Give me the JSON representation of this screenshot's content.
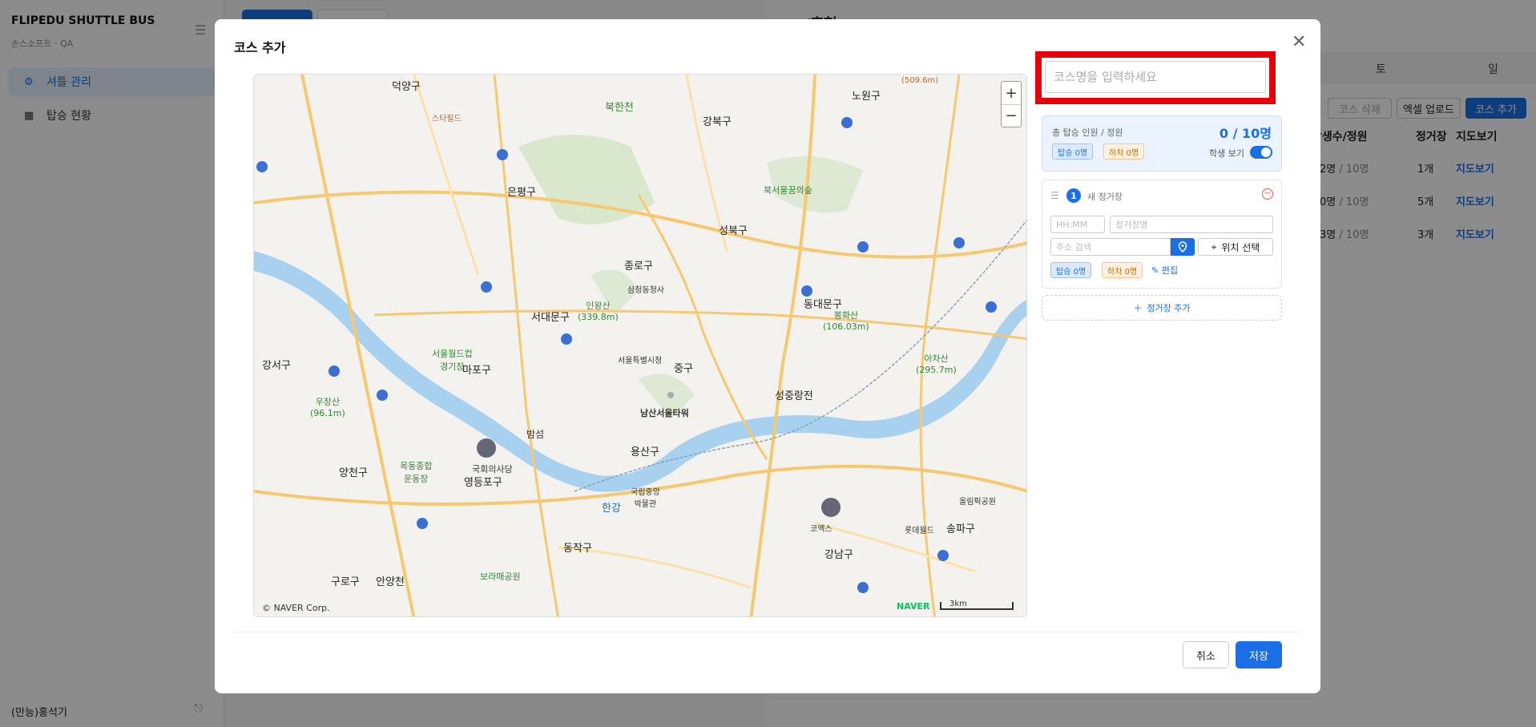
{
  "sidebar": {
    "brand": "FLIPEDU SHUTTLE BUS",
    "brand_sub": "손스소프트 · QA",
    "items": [
      {
        "label": "셔틀 관리",
        "icon": "gear-icon"
      },
      {
        "label": "탑승 현황",
        "icon": "calendar-icon"
      }
    ],
    "user": "(만능)홍석기"
  },
  "drawer": {
    "title": "…/훈협",
    "tabs": [
      "토",
      "일"
    ],
    "buttons": {
      "delete": "코스 삭제",
      "excel": "엑셀 업로드",
      "add": "코스 추가"
    },
    "columns": [
      "학생수/정원",
      "정거장",
      "지도보기"
    ],
    "rows": [
      {
        "students": "2명",
        "capacity": "/ 10명",
        "stops": "1개",
        "map": "지도보기"
      },
      {
        "students": "0명",
        "capacity": "/ 10명",
        "stops": "5개",
        "map": "지도보기"
      },
      {
        "students": "3명",
        "capacity": "/ 10명",
        "stops": "3개",
        "map": "지도보기"
      }
    ]
  },
  "modal": {
    "title": "코스 추가",
    "course_name_placeholder": "코스명을 입력하세요",
    "summary": {
      "label": "총 탑승 인원 / 정원",
      "value": "0 / 10명",
      "board": "탑승 0명",
      "alight": "하차 0명",
      "toggle_label": "학생 보기",
      "toggle_on": true
    },
    "stop": {
      "number": "1",
      "title": "새 정거장",
      "time_placeholder": "HH:MM",
      "name_placeholder": "정거장명",
      "address_placeholder": "주소 검색",
      "locate_label": "위치 선택",
      "board": "탑승 0명",
      "alight": "하차 0명",
      "edit": "편집"
    },
    "add_stop": "정거장 추가",
    "cancel": "취소",
    "save": "저장"
  },
  "map": {
    "copyright": "© NAVER Corp.",
    "logo": "NAVER",
    "scale": "3km",
    "zoom_in": "+",
    "zoom_out": "−",
    "labels": {
      "deokyang": "덕양구",
      "bukhancheon": "북한천",
      "gangbuk": "강북구",
      "nowon": "노원구",
      "eunpyeong": "은평구",
      "seongbuk": "성북구",
      "jongno": "종로구",
      "seodaemun": "서대문구",
      "dongdaemun": "동대문구",
      "jung": "중구",
      "mapo": "마포구",
      "gangseo": "강서구",
      "seongdong": "성중랑전",
      "yongsan": "용산구",
      "yangcheon": "양천구",
      "yeongdeungpo": "영등포구",
      "dongjak": "동작구",
      "guro": "구로구",
      "gangnam": "강남구",
      "songpa": "송파구",
      "namsan": "남산서울타워",
      "olympic": "올림픽공원",
      "lotte": "롯데월드",
      "coex": "코엑스",
      "museum": "국립중앙\n박물관",
      "assembly": "국회의사당",
      "worldcup": "서울월드컵\n경기장",
      "inwang": "인왕산\n(339.8m)",
      "bongwhasan": "봉화산\n(106.03m)",
      "achasan": "아차산\n(295.7m)",
      "ujang": "우장산\n(96.1m)",
      "bukseoul": "북서울꿈의숲",
      "hangang": "한강",
      "bamseom": "밤섬",
      "anyangcheon": "안양천",
      "mokdong": "목동종합\n운동장",
      "borame": "보라매공원",
      "peak": "(509.6m)",
      "starfield": "스타필드",
      "cityhall": "서울특별시청",
      "gwanghwamun": "삼청동청사"
    }
  }
}
